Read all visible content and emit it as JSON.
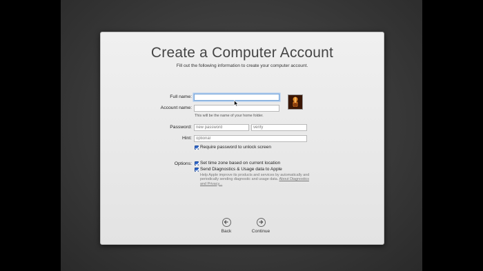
{
  "title": "Create a Computer Account",
  "subtitle": "Fill out the following information to create your computer account.",
  "form": {
    "full_name_label": "Full name:",
    "full_name_value": "",
    "account_name_label": "Account name:",
    "account_name_value": "",
    "account_name_note": "This will be the name of your home folder.",
    "password_label": "Password:",
    "password_placeholder": "new password",
    "verify_placeholder": "verify",
    "hint_label": "Hint:",
    "hint_placeholder": "optional",
    "require_password_label": "Require password to unlock screen",
    "require_password_checked": true
  },
  "options": {
    "label": "Options:",
    "timezone_label": "Set time zone based on current location",
    "timezone_checked": true,
    "diagnostics_label": "Send Diagnostics & Usage data to Apple",
    "diagnostics_checked": true,
    "diagnostics_help": "Help Apple improve its products and services by automatically and periodically sending diagnostic and usage data.",
    "diagnostics_link": "About Diagnostics and Privacy..."
  },
  "nav": {
    "back_label": "Back",
    "continue_label": "Continue"
  },
  "icons": {
    "back": "left-arrow-circle-icon",
    "continue": "right-arrow-circle-icon",
    "checkbox": "checkmark-icon",
    "avatar": "user-picture-guitar"
  },
  "colors": {
    "checkbox_blue": "#2f66c9",
    "focus_ring": "#a8c8ee"
  }
}
